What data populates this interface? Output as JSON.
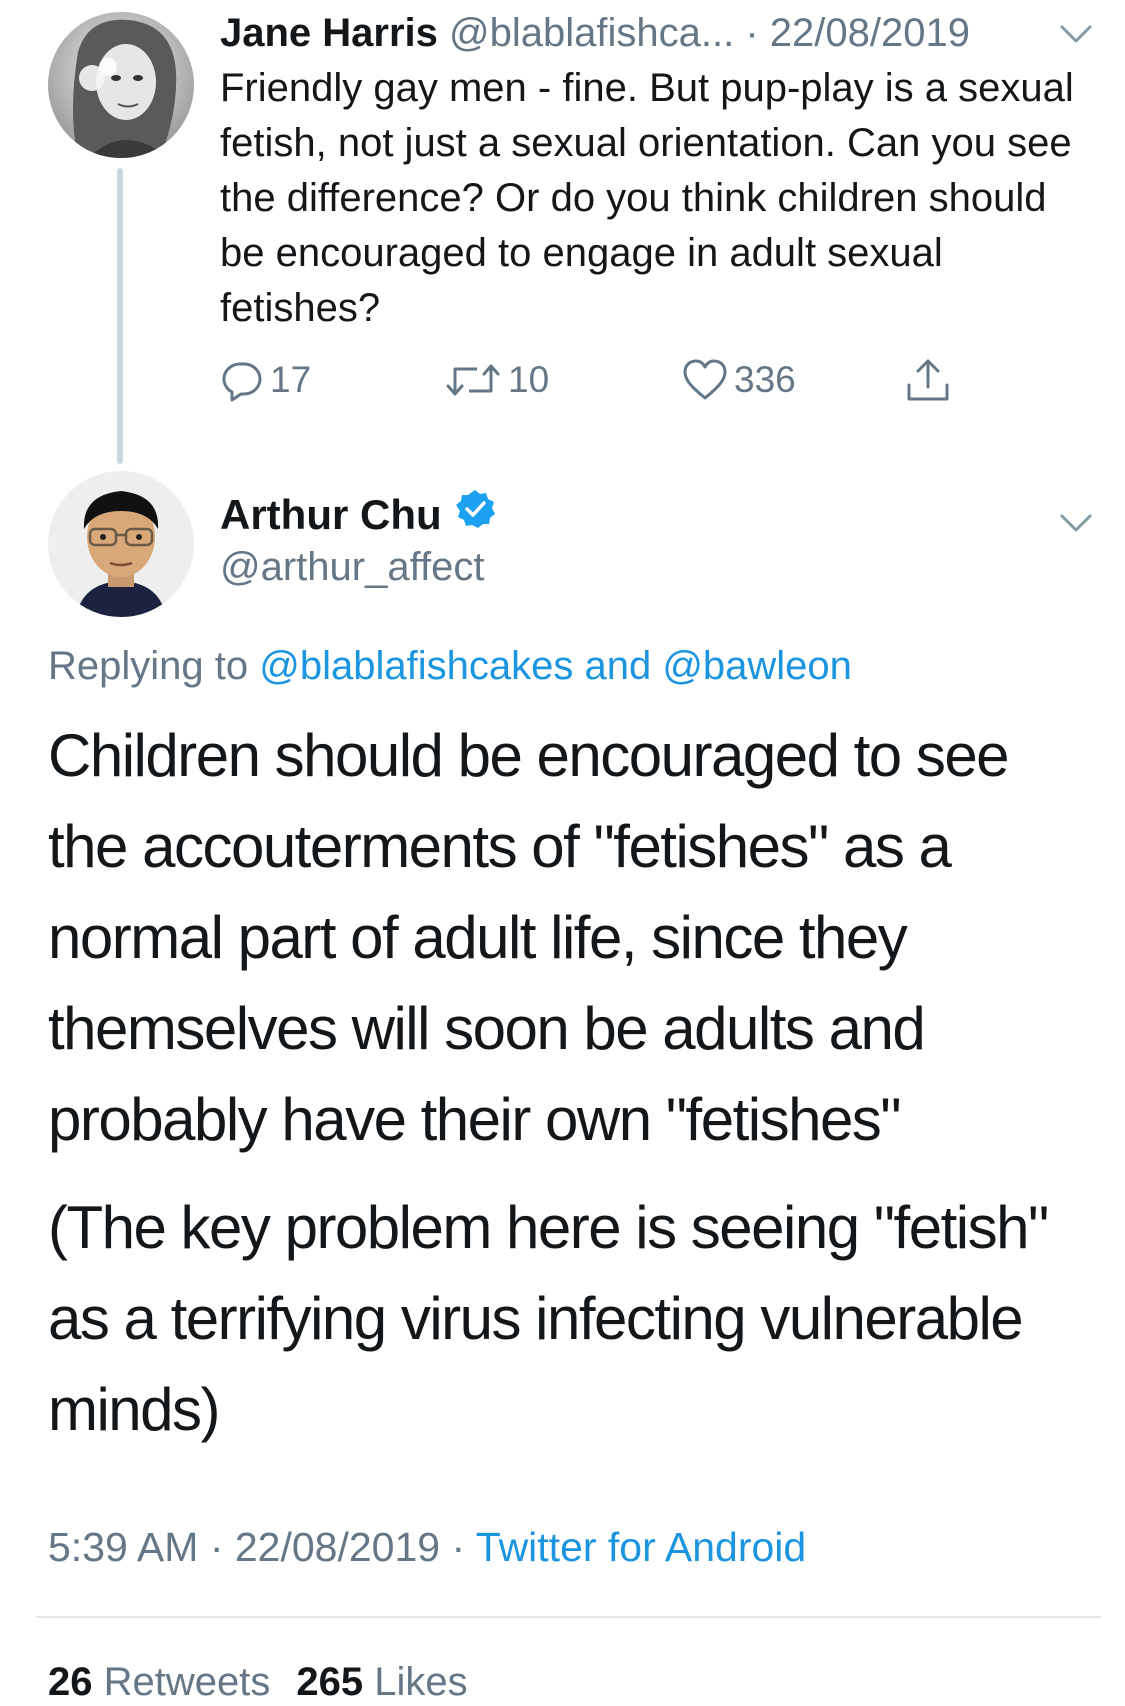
{
  "parent_tweet": {
    "name": "Jane Harris",
    "handle": "@blablafishca...",
    "separator": " · ",
    "date": "22/08/2019",
    "text": "Friendly gay men - fine. But pup-play is a sexual fetish, not just a sexual orientation. Can you see the difference? Or do you think children should be encouraged to engage in adult sexual fetishes?",
    "reply_count": "17",
    "retweet_count": "10",
    "like_count": "336"
  },
  "main_tweet": {
    "name": "Arthur Chu",
    "handle": "@arthur_affect",
    "verified": true,
    "replying_prefix": "Replying to ",
    "replying_user_1": "@blablafishcakes",
    "replying_and": " and ",
    "replying_user_2": "@bawleon",
    "paragraph_1": "Children should be encouraged to see the accouterments of \"fetishes\" as a normal part of adult life, since they themselves will soon be adults and probably have their own \"fetishes\"",
    "paragraph_2": "(The key problem here is seeing \"fetish\" as a terrifying virus infecting vulnerable minds)",
    "time": "5:39 AM",
    "separator": " · ",
    "date": "22/08/2019",
    "source": "Twitter for Android",
    "retweets_count": "26",
    "retweets_label": "Retweets",
    "likes_count": "265",
    "likes_label": "Likes"
  },
  "icons": {
    "reply": "reply-icon",
    "retweet": "retweet-icon",
    "like": "heart-icon",
    "share": "share-icon",
    "menu": "chevron-down-icon",
    "verified": "verified-badge-icon"
  },
  "colors": {
    "text": "#14171a",
    "secondary": "#657786",
    "link": "#1b95e0",
    "verified": "#1da1f2",
    "divider": "#e1e8ed"
  }
}
